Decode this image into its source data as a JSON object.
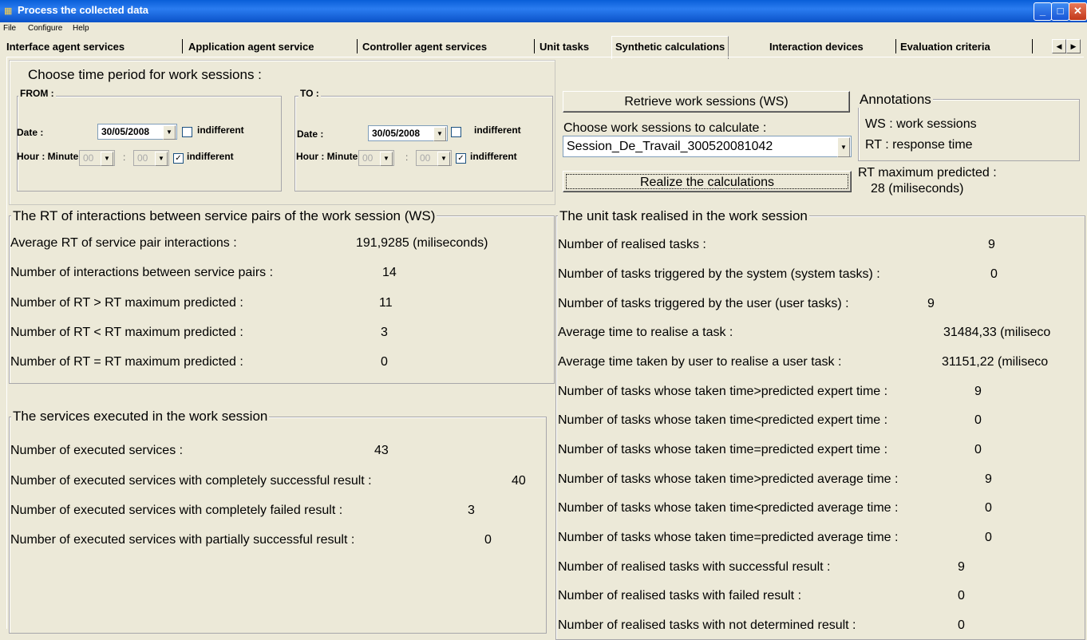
{
  "window": {
    "title": "Process the collected data"
  },
  "menu": [
    "File",
    "Configure",
    "Help"
  ],
  "tabs": [
    "Interface agent services",
    "Application agent service",
    "Controller agent services",
    "Unit tasks",
    "Synthetic calculations",
    "Interaction devices",
    "Evaluation criteria"
  ],
  "active_tab": "Synthetic calculations",
  "period": {
    "heading": "Choose time period for work sessions :",
    "from": {
      "label": "FROM :",
      "date_label": "Date :",
      "date": "30/05/2008",
      "indifferent": "indifferent",
      "hour_label": "Hour : Minute",
      "hour": "00",
      "minute": "00"
    },
    "to": {
      "label": "TO :",
      "date_label": "Date :",
      "date": "30/05/2008",
      "indifferent": "indifferent",
      "hour_label": "Hour : Minute",
      "hour": "00",
      "minute": "00"
    }
  },
  "actions": {
    "retrieve": "Retrieve work sessions (WS)",
    "choose_label": "Choose work sessions to calculate :",
    "session": "Session_De_Travail_300520081042",
    "realize": "Realize the calculations"
  },
  "annotations": {
    "title": "Annotations",
    "ws": "WS : work sessions",
    "rt": "RT : response time",
    "rt_max_label": "RT maximum predicted :",
    "rt_max_value": "28  (miliseconds)"
  },
  "rt_group": {
    "title": "The RT of interactions between service pairs of the work session (WS)",
    "rows": [
      {
        "label": "Average RT of service pair interactions :",
        "value": "191,9285 (miliseconds)"
      },
      {
        "label": "Number of interactions between service pairs :",
        "value": "14"
      },
      {
        "label": "Number of RT > RT maximum predicted  :",
        "value": "11"
      },
      {
        "label": "Number of RT < RT maximum predicted :",
        "value": "3"
      },
      {
        "label": "Number of RT = RT maximum predicted :",
        "value": "0"
      }
    ]
  },
  "services_group": {
    "title": "The services executed in the work session",
    "rows": [
      {
        "label": "Number of executed services :",
        "value": "43"
      },
      {
        "label": "Number of executed services with completely successful result :",
        "value": "40"
      },
      {
        "label": "Number of executed services with completely failed result :",
        "value": "3"
      },
      {
        "label": "Number of executed services with partially successful result :",
        "value": "0"
      }
    ]
  },
  "tasks_group": {
    "title": "The unit task realised in the work session",
    "rows": [
      {
        "label": "Number of realised tasks :",
        "value": "9"
      },
      {
        "label": "Number of tasks triggered by the system (system tasks) :",
        "value": "0"
      },
      {
        "label": "Number of tasks triggered by the user (user tasks) :",
        "value": "9"
      },
      {
        "label": "Average time to realise a task :",
        "value": "31484,33 (miliseco"
      },
      {
        "label": "Average time taken by user to realise a user task :",
        "value": "31151,22 (miliseco"
      },
      {
        "label": "Number of tasks whose taken time>predicted expert time :",
        "value": "9"
      },
      {
        "label": "Number of tasks whose taken time<predicted expert time :",
        "value": "0"
      },
      {
        "label": "Number of tasks whose taken time=predicted expert time :",
        "value": "0"
      },
      {
        "label": "Number of tasks whose taken time>predicted average time :",
        "value": "9"
      },
      {
        "label": "Number of tasks whose taken time<predicted average time :",
        "value": "0"
      },
      {
        "label": "Number of tasks whose taken time=predicted average time :",
        "value": "0"
      },
      {
        "label": "Number of realised tasks with successful result :",
        "value": "9"
      },
      {
        "label": "Number of realised tasks with failed result :",
        "value": "0"
      },
      {
        "label": "Number of realised tasks with not determined result :",
        "value": "0"
      }
    ]
  }
}
